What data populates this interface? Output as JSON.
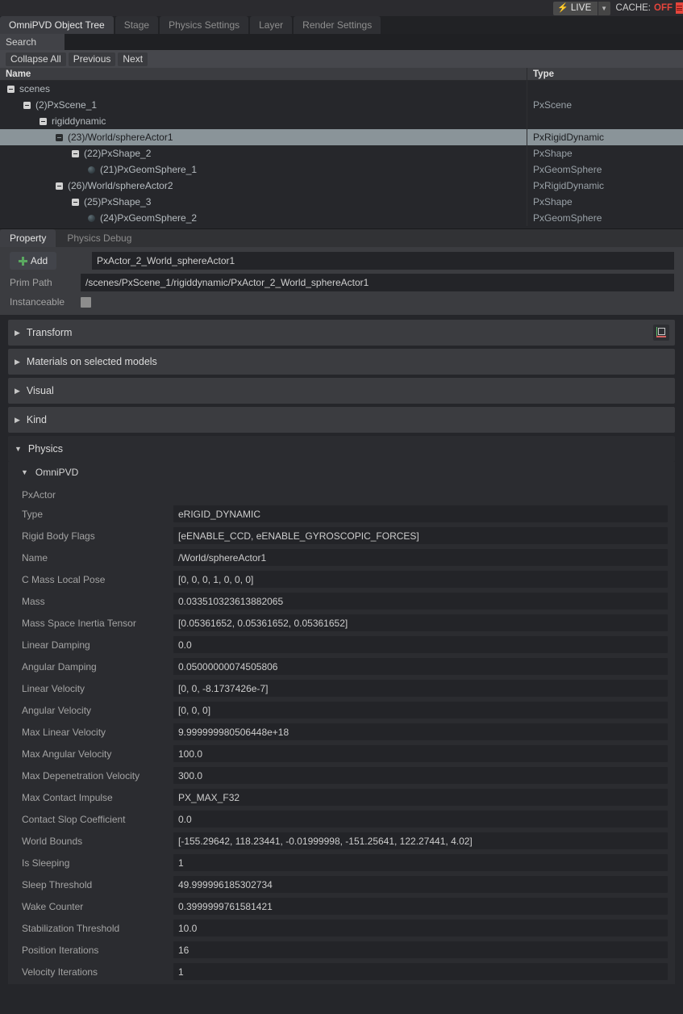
{
  "statusbar": {
    "live_label": "LIVE",
    "bolt_icon": "lightning-bolt-icon",
    "caret_icon": "chevron-down-icon",
    "cache_label": "CACHE:",
    "cache_value": "OFF",
    "cache_icon": "cache-stack-icon",
    "live_bg": "#4a4a4a",
    "cache_color": "#e5453c"
  },
  "tabs": [
    {
      "label": "OmniPVD Object Tree",
      "active": true
    },
    {
      "label": "Stage",
      "active": false
    },
    {
      "label": "Physics Settings",
      "active": false
    },
    {
      "label": "Layer",
      "active": false
    },
    {
      "label": "Render Settings",
      "active": false
    }
  ],
  "search": {
    "label": "Search",
    "value": "",
    "placeholder": ""
  },
  "tree_buttons": [
    {
      "label": "Collapse All"
    },
    {
      "label": "Previous"
    },
    {
      "label": "Next"
    }
  ],
  "tree": {
    "columns": {
      "name": "Name",
      "type": "Type"
    },
    "rows": [
      {
        "indent": 0,
        "icon": "collapse-box-icon",
        "name": "scenes",
        "type": "",
        "selected": false
      },
      {
        "indent": 1,
        "icon": "collapse-box-icon",
        "name": "(2)PxScene_1",
        "type": "PxScene",
        "selected": false
      },
      {
        "indent": 2,
        "icon": "collapse-box-icon",
        "name": "rigiddynamic",
        "type": "",
        "selected": false
      },
      {
        "indent": 3,
        "icon": "collapse-box-icon",
        "name": "(23)/World/sphereActor1",
        "type": "PxRigidDynamic",
        "selected": true
      },
      {
        "indent": 4,
        "icon": "collapse-box-icon",
        "name": "(22)PxShape_2",
        "type": "PxShape",
        "selected": false
      },
      {
        "indent": 5,
        "icon": "sphere-icon",
        "name": "(21)PxGeomSphere_1",
        "type": "PxGeomSphere",
        "selected": false
      },
      {
        "indent": 3,
        "icon": "collapse-box-icon",
        "name": "(26)/World/sphereActor2",
        "type": "PxRigidDynamic",
        "selected": false
      },
      {
        "indent": 4,
        "icon": "collapse-box-icon",
        "name": "(25)PxShape_3",
        "type": "PxShape",
        "selected": false
      },
      {
        "indent": 5,
        "icon": "sphere-icon",
        "name": "(24)PxGeomSphere_2",
        "type": "PxGeomSphere",
        "selected": false
      }
    ]
  },
  "property_tabs": [
    {
      "label": "Property",
      "active": true
    },
    {
      "label": "Physics Debug",
      "active": false
    }
  ],
  "header_form": {
    "add_label": "Add",
    "add_icon": "plus-icon",
    "name_value": "PxActor_2_World_sphereActor1",
    "prim_path_label": "Prim Path",
    "prim_path_value": "/scenes/PxScene_1/rigiddynamic/PxActor_2_World_sphereActor1",
    "instanceable_label": "Instanceable",
    "instanceable_checked": true
  },
  "sections": [
    {
      "label": "Transform",
      "expanded": false,
      "gizmo": "transform-axis-icon"
    },
    {
      "label": "Materials on selected models",
      "expanded": false,
      "gizmo": null
    },
    {
      "label": "Visual",
      "expanded": false,
      "gizmo": null
    },
    {
      "label": "Kind",
      "expanded": false,
      "gizmo": null
    },
    {
      "label": "Physics",
      "expanded": true,
      "gizmo": null
    }
  ],
  "omnipvd": {
    "title": "OmniPVD",
    "expanded": true,
    "group_label": "PxActor",
    "properties": [
      {
        "name": "Type",
        "value": "eRIGID_DYNAMIC"
      },
      {
        "name": "Rigid Body Flags",
        "value": "[eENABLE_CCD, eENABLE_GYROSCOPIC_FORCES]"
      },
      {
        "name": "Name",
        "value": "/World/sphereActor1"
      },
      {
        "name": "C Mass Local Pose",
        "value": "[0, 0, 0, 1, 0, 0, 0]"
      },
      {
        "name": "Mass",
        "value": "0.033510323613882065"
      },
      {
        "name": "Mass Space Inertia Tensor",
        "value": "[0.05361652, 0.05361652, 0.05361652]"
      },
      {
        "name": "Linear Damping",
        "value": "0.0"
      },
      {
        "name": "Angular Damping",
        "value": "0.05000000074505806"
      },
      {
        "name": "Linear Velocity",
        "value": "[0, 0, -8.1737426e-7]"
      },
      {
        "name": "Angular Velocity",
        "value": "[0, 0, 0]"
      },
      {
        "name": "Max Linear Velocity",
        "value": "9.999999980506448e+18"
      },
      {
        "name": "Max Angular Velocity",
        "value": "100.0"
      },
      {
        "name": "Max Depenetration Velocity",
        "value": "300.0"
      },
      {
        "name": "Max Contact Impulse",
        "value": "PX_MAX_F32"
      },
      {
        "name": "Contact Slop Coefficient",
        "value": "0.0"
      },
      {
        "name": "World Bounds",
        "value": "[-155.29642, 118.23441, -0.01999998, -151.25641, 122.27441, 4.02]"
      },
      {
        "name": "Is Sleeping",
        "value": "1"
      },
      {
        "name": "Sleep Threshold",
        "value": "49.999996185302734"
      },
      {
        "name": "Wake Counter",
        "value": "0.3999999761581421"
      },
      {
        "name": "Stabilization Threshold",
        "value": "10.0"
      },
      {
        "name": "Position Iterations",
        "value": "16"
      },
      {
        "name": "Velocity Iterations",
        "value": "1"
      }
    ]
  }
}
